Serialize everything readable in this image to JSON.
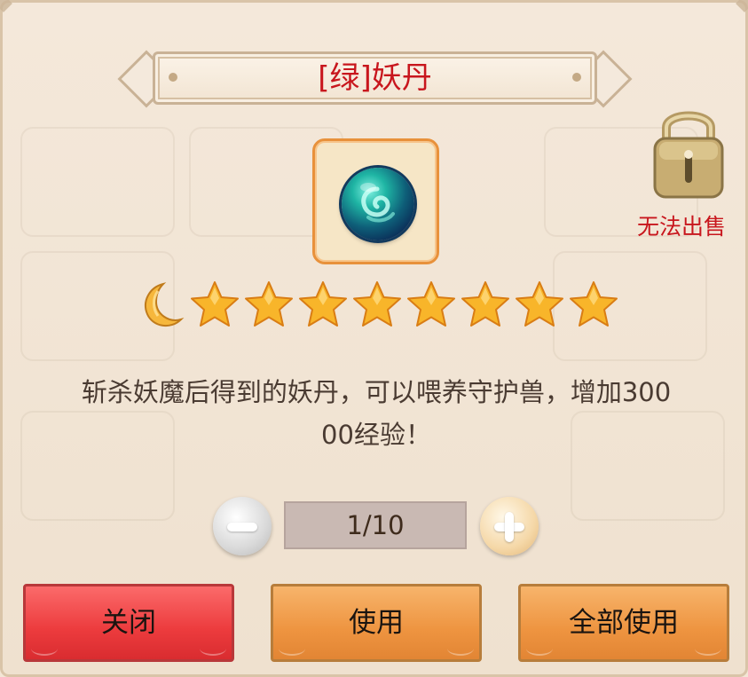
{
  "title": "[绿]妖丹",
  "item": {
    "icon": "green-demon-pill-orb-icon"
  },
  "sale_status": {
    "icon": "lock-icon",
    "label": "无法出售"
  },
  "rating": {
    "moon_count": 1,
    "star_count": 8
  },
  "description": {
    "line1": "斩杀妖魔后得到的妖丹，可以喂养守护兽，增加300",
    "line2": "00经验！"
  },
  "quantity": {
    "display": "1/10"
  },
  "buttons": {
    "close": "关闭",
    "use": "使用",
    "use_all": "全部使用"
  },
  "colors": {
    "title": "#c8161d",
    "no_sale": "#c8161d",
    "close_button": "#ec3b3d",
    "use_button": "#ee9440"
  }
}
